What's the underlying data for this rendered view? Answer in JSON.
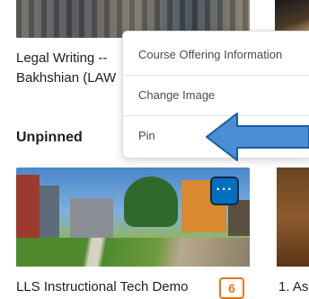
{
  "pinned": {
    "course_title": "Legal Writing -- Bakhshian (LAW"
  },
  "unpinned": {
    "section_title": "Unpinned",
    "cards": [
      {
        "title": "LLS Instructional Tech Demo",
        "notification_count": "6"
      },
      {
        "title": "1. As"
      }
    ]
  },
  "more_button": {
    "label": "···"
  },
  "context_menu": {
    "items": [
      {
        "label": "Course Offering Information"
      },
      {
        "label": "Change Image"
      },
      {
        "label": "Pin"
      }
    ]
  },
  "colors": {
    "primary": "#006fbf",
    "badge": "#e87511",
    "arrow_fill": "#4a8fd6",
    "arrow_stroke": "#1b5a9e"
  }
}
